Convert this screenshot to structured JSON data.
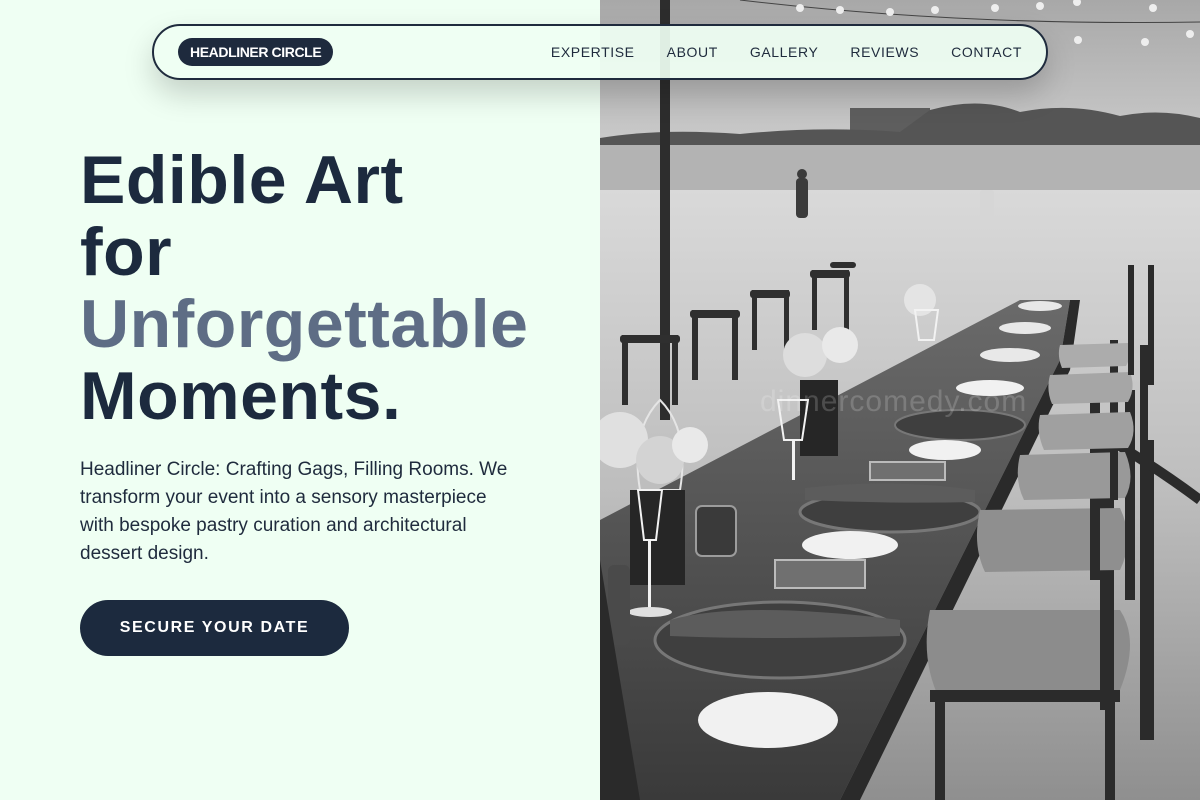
{
  "nav": {
    "brand": "HEADLINER CIRCLE",
    "links": [
      "EXPERTISE",
      "ABOUT",
      "GALLERY",
      "REVIEWS",
      "CONTACT"
    ]
  },
  "hero": {
    "title_line1": "Edible Art",
    "title_line2": "for",
    "title_accent": "Unforgettable",
    "title_line4": "Moments.",
    "description": "Headliner Circle: Crafting Gags, Filling Rooms. We transform your event into a sensory masterpiece with bespoke pastry curation and architectural dessert design.",
    "cta_label": "SECURE YOUR DATE"
  },
  "photo": {
    "watermark": "dinnercomedy.com",
    "description_icon": "beach-dinner-table-photo"
  },
  "colors": {
    "background": "#effff3",
    "navy": "#1c2a3e",
    "accent_slate": "#5e6d85"
  }
}
